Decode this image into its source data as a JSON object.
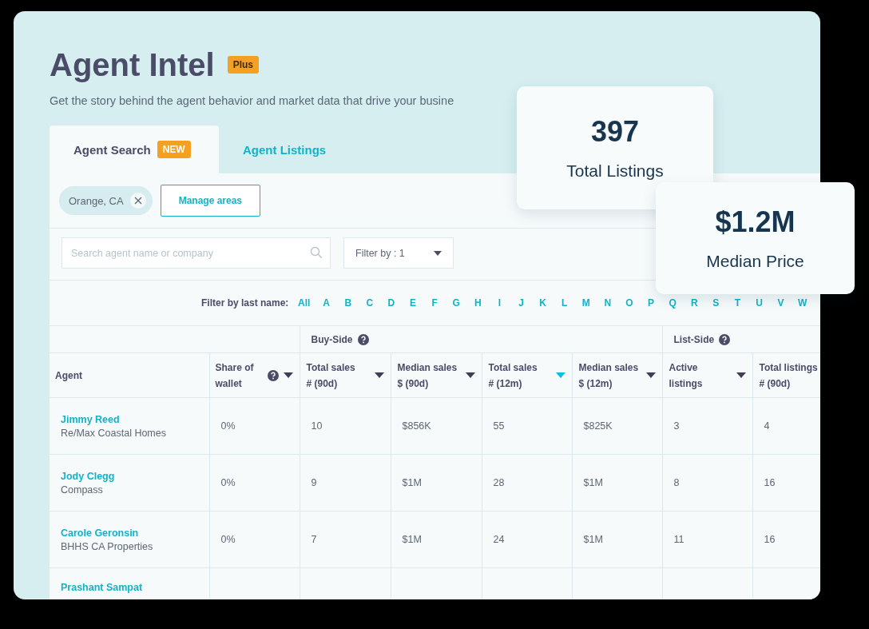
{
  "header": {
    "title": "Agent Intel",
    "badge": "Plus",
    "subtitle": "Get the story behind the agent behavior and market data that drive your busine"
  },
  "tabs": [
    {
      "label": "Agent Search",
      "badge": "NEW",
      "selected": true
    },
    {
      "label": "Agent Listings",
      "selected": false
    }
  ],
  "area_chips": [
    {
      "label": "Orange, CA"
    }
  ],
  "manage_button": "Manage areas",
  "search": {
    "placeholder": "Search agent name or company"
  },
  "filter_dropdown": {
    "value": "Filter by : 1"
  },
  "letter_filter": {
    "label": "Filter by last name:",
    "letters": [
      "All",
      "A",
      "B",
      "C",
      "D",
      "E",
      "F",
      "G",
      "H",
      "I",
      "J",
      "K",
      "L",
      "M",
      "N",
      "O",
      "P",
      "Q",
      "R",
      "S",
      "T",
      "U",
      "V",
      "W"
    ]
  },
  "table": {
    "lead_columns": [
      {
        "lines": [
          "Agent"
        ],
        "help": false,
        "sortable": false
      },
      {
        "lines": [
          "Share of",
          "wallet"
        ],
        "help": true,
        "sortable": true,
        "sorted": false
      }
    ],
    "groups": [
      {
        "label": "Buy-Side",
        "help": true,
        "columns": [
          {
            "lines": [
              "Total sales",
              "# (90d)"
            ],
            "help": false,
            "sortable": true,
            "sorted": false
          },
          {
            "lines": [
              "Median sales",
              "$ (90d)"
            ],
            "help": false,
            "sortable": true,
            "sorted": false
          },
          {
            "lines": [
              "Total sales",
              "# (12m)"
            ],
            "help": false,
            "sortable": true,
            "sorted": true
          },
          {
            "lines": [
              "Median sales",
              "$ (12m)"
            ],
            "help": false,
            "sortable": true,
            "sorted": false
          }
        ]
      },
      {
        "label": "List-Side",
        "help": true,
        "columns": [
          {
            "lines": [
              "Active",
              "listings"
            ],
            "help": false,
            "sortable": true,
            "sorted": false
          },
          {
            "lines": [
              "Total listings",
              "# (90d)"
            ]
          }
        ]
      }
    ],
    "rows": [
      {
        "name": "Jimmy Reed",
        "company": "Re/Max Coastal Homes",
        "values": [
          "0%",
          "10",
          "$856K",
          "55",
          "$825K",
          "3",
          "4"
        ]
      },
      {
        "name": "Jody Clegg",
        "company": "Compass",
        "values": [
          "0%",
          "9",
          "$1M",
          "28",
          "$1M",
          "8",
          "16"
        ]
      },
      {
        "name": "Carole Geronsin",
        "company": "BHHS CA Properties",
        "values": [
          "0%",
          "7",
          "$1M",
          "24",
          "$1M",
          "11",
          "16"
        ]
      },
      {
        "name": "Prashant Sampat"
      }
    ]
  },
  "stat_cards": [
    {
      "value": "397",
      "label": "Total Listings"
    },
    {
      "value": "$1.2M",
      "label": "Median Price"
    }
  ]
}
